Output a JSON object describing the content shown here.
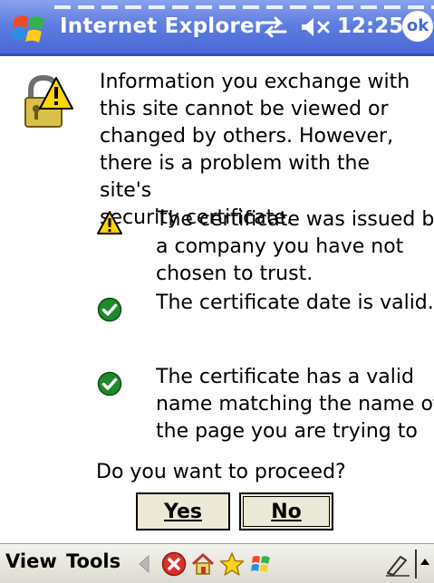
{
  "titlebar": {
    "app_title": "Internet Explorer",
    "clock": "12:25",
    "ok_label": "ok",
    "icons": [
      "windows-start-icon",
      "connectivity-icon",
      "volume-muted-icon"
    ]
  },
  "dialog": {
    "message": "Information you exchange with this site cannot be viewed or changed by others. However, there is a problem with the site's security certificate.",
    "lines": [
      "Information you exchange with",
      "this site cannot be viewed or",
      "changed by others. However,",
      "there is a problem with the site's",
      "security certificate."
    ],
    "items": [
      {
        "status": "warning",
        "icon": "warning-icon",
        "lines": [
          "The certificate was issued by",
          "a company you have not",
          "chosen to trust."
        ]
      },
      {
        "status": "ok",
        "icon": "check-icon",
        "lines": [
          "The certificate date is valid."
        ]
      },
      {
        "status": "ok",
        "icon": "check-icon",
        "lines": [
          "The certificate has a valid",
          "name matching the name of",
          "the page you are trying to"
        ]
      }
    ],
    "question": "Do you want to proceed?",
    "yes_label": "Yes",
    "no_label": "No"
  },
  "menubar": {
    "view": "View",
    "tools": "Tools",
    "icons": [
      "back-icon",
      "stop-icon",
      "home-icon",
      "favorites-icon",
      "windows-flag-icon",
      "input-panel-icon"
    ]
  },
  "colors": {
    "title_bar": "#5f7ee0",
    "warning": "#ffd700",
    "check": "#1f8a2a",
    "stop": "#d9322b"
  }
}
